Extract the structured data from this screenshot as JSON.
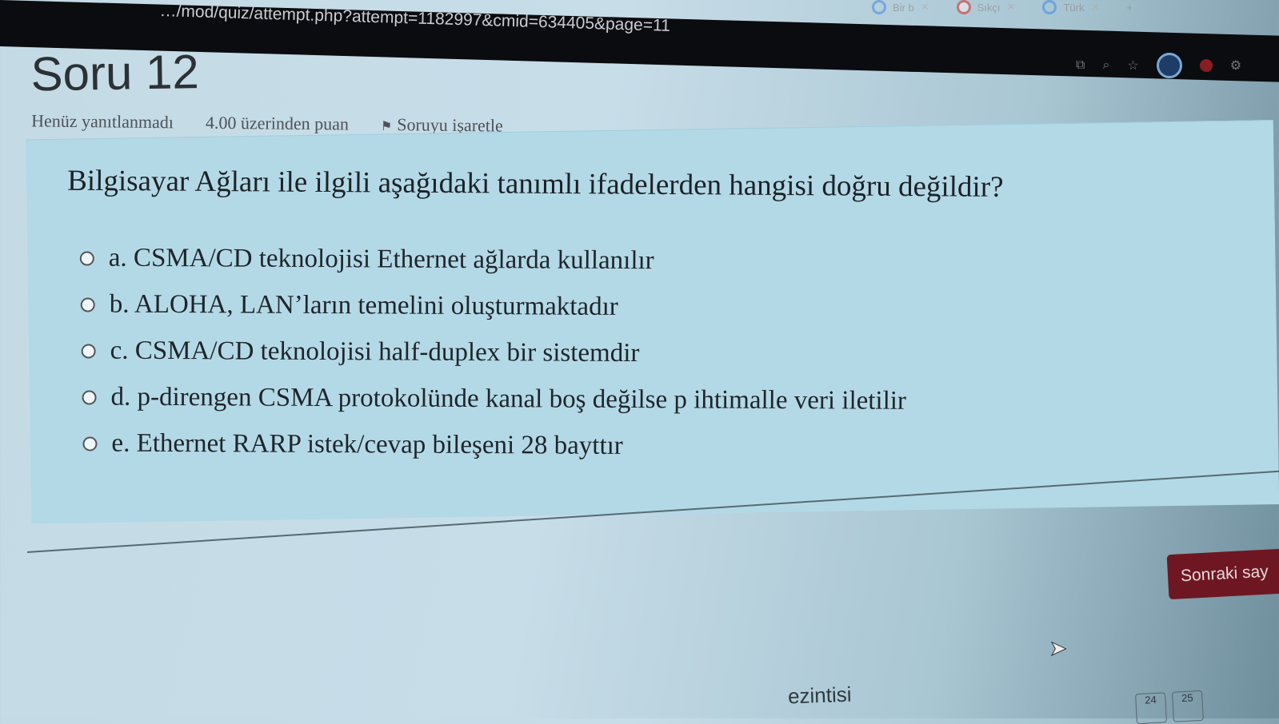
{
  "browser": {
    "url": "…/mod/quiz/attempt.php?attempt=1182997&cmid=634405&page=11",
    "tabs": [
      {
        "label": "Bir b",
        "icon": "google-icon"
      },
      {
        "label": "Sıkçı",
        "icon": "opera-icon"
      },
      {
        "label": "Türk",
        "icon": "google-icon"
      }
    ]
  },
  "question": {
    "title": "Soru 12",
    "status": "Henüz yanıtlanmadı",
    "points": "4.00 üzerinden puan",
    "flag_label": "Soruyu işaretle",
    "text": "Bilgisayar Ağları ile ilgili aşağıdaki tanımlı ifadelerden hangisi doğru değildir?",
    "answers": [
      "a. CSMA/CD teknolojisi Ethernet ağlarda kullanılır",
      "b. ALOHA, LAN’ların temelini oluşturmaktadır",
      "c. CSMA/CD teknolojisi half-duplex bir sistemdir",
      "d. p-direngen CSMA protokolünde kanal boş değilse p ihtimalle veri iletilir",
      "e. Ethernet RARP istek/cevap bileşeni 28 bayttır"
    ]
  },
  "next_button": "Sonraki say",
  "nav_title_fragment": "ezintisi",
  "pages": [
    "24",
    "25"
  ]
}
